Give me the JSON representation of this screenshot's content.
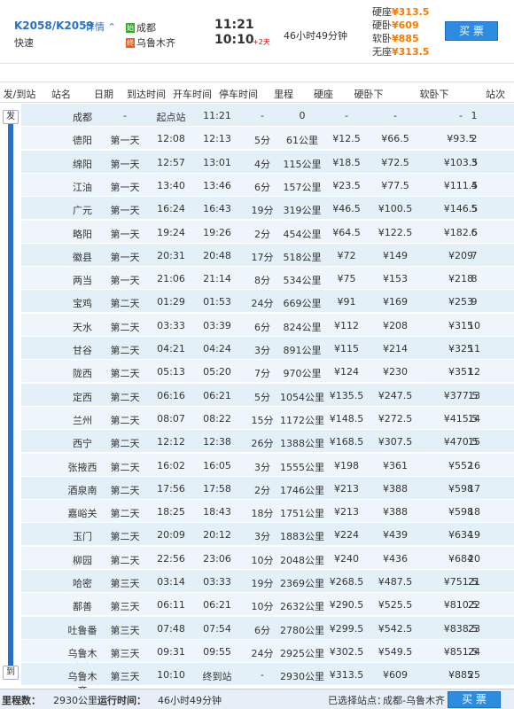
{
  "header": {
    "train_no": "K2058/K2059",
    "detail_link": "详情",
    "train_type": "快速",
    "from_badge": "始",
    "from_station": "成都",
    "to_badge": "终",
    "to_station": "乌鲁木齐",
    "dep_time": "11:21",
    "arr_time": "10:10",
    "plus_day": "+2天",
    "duration": "46小时49分钟",
    "prices": [
      {
        "label": "硬座",
        "price": "¥313.5"
      },
      {
        "label": "硬卧",
        "price": "¥609"
      },
      {
        "label": "软卧",
        "price": "¥885"
      },
      {
        "label": "无座",
        "price": "¥313.5"
      }
    ],
    "buy_label": "买 票"
  },
  "columns": [
    "发/到站",
    "站名",
    "日期",
    "到达时间",
    "开车时间",
    "停车时间",
    "里程",
    "硬座",
    "硬卧下",
    "软卧下",
    "站次"
  ],
  "side_tags": {
    "dep": "发",
    "arr": "到"
  },
  "rows": [
    [
      "成都",
      "-",
      "起点站",
      "11:21",
      "-",
      "0",
      "-",
      "-",
      "-",
      "1"
    ],
    [
      "德阳",
      "第一天",
      "12:08",
      "12:13",
      "5分",
      "61公里",
      "¥12.5",
      "¥66.5",
      "¥93.5",
      "2"
    ],
    [
      "绵阳",
      "第一天",
      "12:57",
      "13:01",
      "4分",
      "115公里",
      "¥18.5",
      "¥72.5",
      "¥103.5",
      "3"
    ],
    [
      "江油",
      "第一天",
      "13:40",
      "13:46",
      "6分",
      "157公里",
      "¥23.5",
      "¥77.5",
      "¥111.5",
      "4"
    ],
    [
      "广元",
      "第一天",
      "16:24",
      "16:43",
      "19分",
      "319公里",
      "¥46.5",
      "¥100.5",
      "¥146.5",
      "5"
    ],
    [
      "略阳",
      "第一天",
      "19:24",
      "19:26",
      "2分",
      "454公里",
      "¥64.5",
      "¥122.5",
      "¥182.5",
      "6"
    ],
    [
      "徽县",
      "第一天",
      "20:31",
      "20:48",
      "17分",
      "518公里",
      "¥72",
      "¥149",
      "¥209",
      "7"
    ],
    [
      "两当",
      "第一天",
      "21:06",
      "21:14",
      "8分",
      "534公里",
      "¥75",
      "¥153",
      "¥218",
      "8"
    ],
    [
      "宝鸡",
      "第二天",
      "01:29",
      "01:53",
      "24分",
      "669公里",
      "¥91",
      "¥169",
      "¥253",
      "9"
    ],
    [
      "天水",
      "第二天",
      "03:33",
      "03:39",
      "6分",
      "824公里",
      "¥112",
      "¥208",
      "¥315",
      "10"
    ],
    [
      "甘谷",
      "第二天",
      "04:21",
      "04:24",
      "3分",
      "891公里",
      "¥115",
      "¥214",
      "¥325",
      "11"
    ],
    [
      "陇西",
      "第二天",
      "05:13",
      "05:20",
      "7分",
      "970公里",
      "¥124",
      "¥230",
      "¥351",
      "12"
    ],
    [
      "定西",
      "第二天",
      "06:16",
      "06:21",
      "5分",
      "1054公里",
      "¥135.5",
      "¥247.5",
      "¥377.5",
      "13"
    ],
    [
      "兰州",
      "第二天",
      "08:07",
      "08:22",
      "15分",
      "1172公里",
      "¥148.5",
      "¥272.5",
      "¥415.5",
      "14"
    ],
    [
      "西宁",
      "第二天",
      "12:12",
      "12:38",
      "26分",
      "1388公里",
      "¥168.5",
      "¥307.5",
      "¥470.5",
      "15"
    ],
    [
      "张掖西",
      "第二天",
      "16:02",
      "16:05",
      "3分",
      "1555公里",
      "¥198",
      "¥361",
      "¥552",
      "16"
    ],
    [
      "酒泉南",
      "第二天",
      "17:56",
      "17:58",
      "2分",
      "1746公里",
      "¥213",
      "¥388",
      "¥598",
      "17"
    ],
    [
      "嘉峪关",
      "第二天",
      "18:25",
      "18:43",
      "18分",
      "1751公里",
      "¥213",
      "¥388",
      "¥598",
      "18"
    ],
    [
      "玉门",
      "第二天",
      "20:09",
      "20:12",
      "3分",
      "1883公里",
      "¥224",
      "¥439",
      "¥634",
      "19"
    ],
    [
      "柳园",
      "第二天",
      "22:56",
      "23:06",
      "10分",
      "2048公里",
      "¥240",
      "¥436",
      "¥684",
      "20"
    ],
    [
      "哈密",
      "第三天",
      "03:14",
      "03:33",
      "19分",
      "2369公里",
      "¥268.5",
      "¥487.5",
      "¥751.5",
      "21"
    ],
    [
      "鄯善",
      "第三天",
      "06:11",
      "06:21",
      "10分",
      "2632公里",
      "¥290.5",
      "¥525.5",
      "¥810.5",
      "22"
    ],
    [
      "吐鲁番",
      "第三天",
      "07:48",
      "07:54",
      "6分",
      "2780公里",
      "¥299.5",
      "¥542.5",
      "¥838.5",
      "23"
    ],
    [
      "乌鲁木齐南",
      "第三天",
      "09:31",
      "09:55",
      "24分",
      "2925公里",
      "¥302.5",
      "¥549.5",
      "¥851.5",
      "24"
    ],
    [
      "乌鲁木齐",
      "第三天",
      "10:10",
      "终到站",
      "-",
      "2930公里",
      "¥313.5",
      "¥609",
      "¥885",
      "25"
    ]
  ],
  "footer": {
    "distance_label": "里程数：",
    "distance": "2930公里",
    "runtime_label": "运行时间：",
    "runtime": "46小时49分钟",
    "selected_label": "已选择站点：",
    "selected": "成都-乌鲁木齐",
    "buy_label": "买 票"
  },
  "colors": {
    "accent": "#2a70c8",
    "price": "#f57c00",
    "button": "#2d8be0",
    "plus_day": "#ee0000"
  }
}
